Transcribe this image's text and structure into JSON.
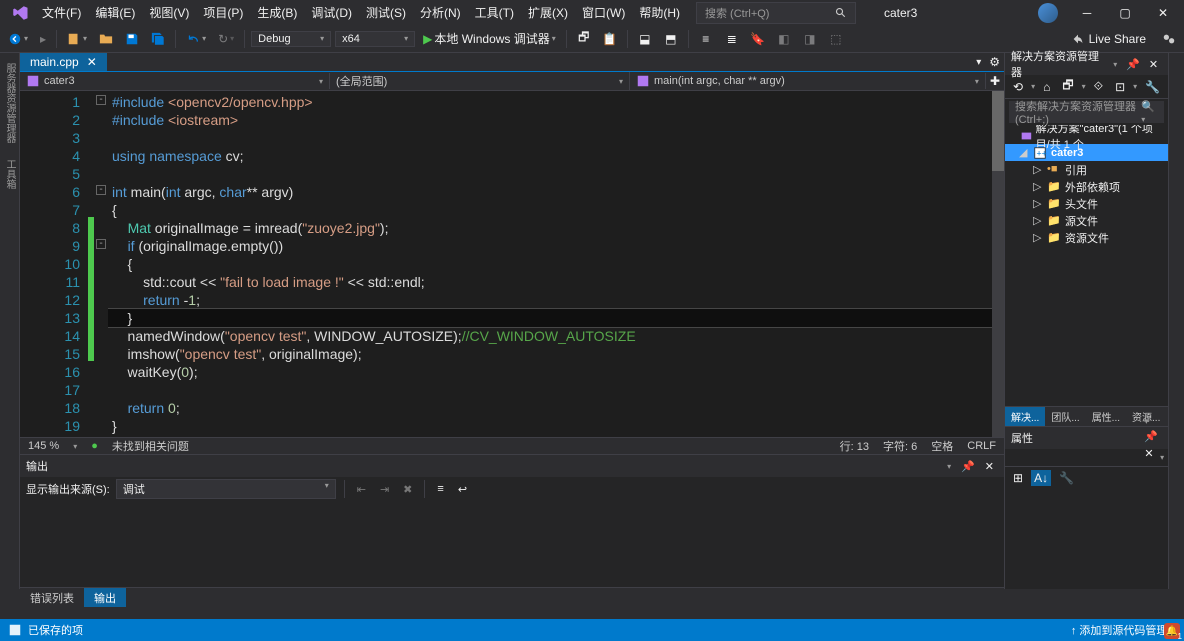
{
  "menu": [
    "文件(F)",
    "编辑(E)",
    "视图(V)",
    "项目(P)",
    "生成(B)",
    "调试(D)",
    "测试(S)",
    "分析(N)",
    "工具(T)",
    "扩展(X)",
    "窗口(W)",
    "帮助(H)"
  ],
  "search_placeholder": "搜索 (Ctrl+Q)",
  "project_name": "cater3",
  "toolbar": {
    "config": "Debug",
    "platform": "x64",
    "target": "本地 Windows 调试器",
    "liveshare": "Live Share"
  },
  "tab": {
    "name": "main.cpp"
  },
  "nav": {
    "scope1": "cater3",
    "scope2": "(全局范围)",
    "scope3": "main(int argc, char ** argv)"
  },
  "code_lines": [
    {
      "n": 1,
      "fold": "-",
      "html": "<span class='kw'>#include</span> <span class='str'>&lt;opencv2/opencv.hpp&gt;</span>"
    },
    {
      "n": 2,
      "html": "<span class='kw'>#include</span> <span class='str'>&lt;iostream&gt;</span>"
    },
    {
      "n": 3,
      "html": ""
    },
    {
      "n": 4,
      "html": "<span class='kw'>using</span> <span class='kw'>namespace</span> cv;"
    },
    {
      "n": 5,
      "html": ""
    },
    {
      "n": 6,
      "fold": "-",
      "html": "<span class='kw'>int</span> main(<span class='kw'>int</span> argc, <span class='kw'>char</span>** argv)"
    },
    {
      "n": 7,
      "html": "{"
    },
    {
      "n": 8,
      "chg": true,
      "html": "    <span class='cls'>Mat</span> originalImage = imread(<span class='str'>\"zuoye2.jpg\"</span>);"
    },
    {
      "n": 9,
      "fold": "-",
      "chg": true,
      "html": "    <span class='kw'>if</span> (originalImage.empty())"
    },
    {
      "n": 10,
      "chg": true,
      "html": "    {"
    },
    {
      "n": 11,
      "chg": true,
      "html": "        std::cout &lt;&lt; <span class='str'>\"fail to load image !\"</span> &lt;&lt; std::endl;"
    },
    {
      "n": 12,
      "chg": true,
      "html": "        <span class='kw'>return</span> -<span class='num'>1</span>;"
    },
    {
      "n": 13,
      "chg": true,
      "cur": true,
      "html": "    }"
    },
    {
      "n": 14,
      "chg": true,
      "html": "    namedWindow(<span class='str'>\"opencv test\"</span>, WINDOW_AUTOSIZE);<span class='cmt'>//CV_WINDOW_AUTOSIZE</span>"
    },
    {
      "n": 15,
      "chg": true,
      "html": "    imshow(<span class='str'>\"opencv test\"</span>, originalImage);"
    },
    {
      "n": 16,
      "html": "    waitKey(<span class='num'>0</span>);"
    },
    {
      "n": 17,
      "html": ""
    },
    {
      "n": 18,
      "html": "    <span class='kw'>return</span> <span class='num'>0</span>;"
    },
    {
      "n": 19,
      "html": "}"
    }
  ],
  "editor_status": {
    "zoom": "145 %",
    "issues": "未找到相关问题",
    "line": "行: 13",
    "col": "字符: 6",
    "ins": "空格",
    "eol": "CRLF"
  },
  "output": {
    "title": "输出",
    "source_label": "显示输出来源(S):",
    "source_value": "调试"
  },
  "bottom_tabs": [
    "错误列表",
    "输出"
  ],
  "solution": {
    "title": "解决方案资源管理器",
    "search_placeholder": "搜索解决方案资源管理器(Ctrl+;)",
    "root": "解决方案\"cater3\"(1 个项目/共 1 个",
    "project": "cater3",
    "nodes": [
      "引用",
      "外部依赖项",
      "头文件",
      "源文件",
      "资源文件"
    ]
  },
  "solution_tabs": [
    "解决...",
    "团队...",
    "属性...",
    "资源..."
  ],
  "properties": {
    "title": "属性"
  },
  "statusbar": {
    "left": "已保存的项",
    "right": "添加到源代码管理"
  },
  "left_rails": [
    "服务器资源管理器",
    "工具箱"
  ],
  "notif_count": "1"
}
